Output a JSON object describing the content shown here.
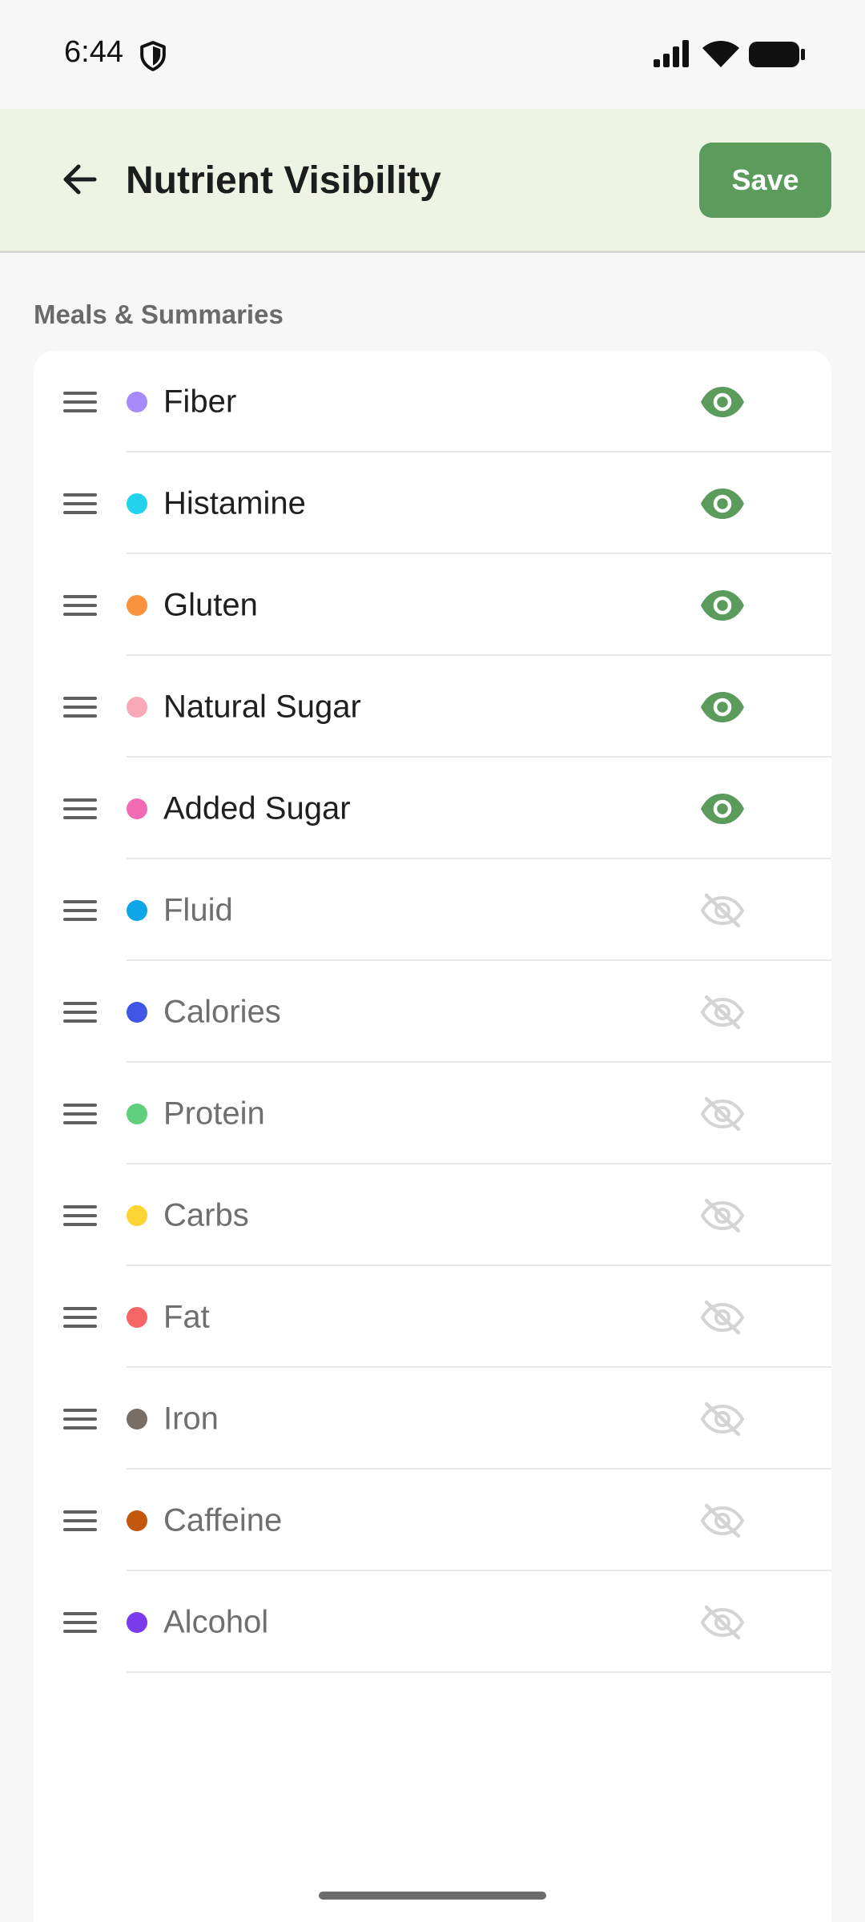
{
  "status_bar": {
    "time": "6:44"
  },
  "header": {
    "title": "Nutrient Visibility",
    "save_label": "Save"
  },
  "section": {
    "title": "Meals & Summaries"
  },
  "colors": {
    "accent": "#5b9b5b",
    "eye_visible": "#5b9b5b",
    "eye_hidden": "#d4d4d4"
  },
  "nutrients": [
    {
      "label": "Fiber",
      "color": "#a78bfa",
      "visible": true
    },
    {
      "label": "Histamine",
      "color": "#22d3ee",
      "visible": true
    },
    {
      "label": "Gluten",
      "color": "#fb923c",
      "visible": true
    },
    {
      "label": "Natural Sugar",
      "color": "#f9a8b8",
      "visible": true
    },
    {
      "label": "Added Sugar",
      "color": "#f06bb4",
      "visible": true
    },
    {
      "label": "Fluid",
      "color": "#0ea5e9",
      "visible": false
    },
    {
      "label": "Calories",
      "color": "#3f56e6",
      "visible": false
    },
    {
      "label": "Protein",
      "color": "#5fcf7e",
      "visible": false
    },
    {
      "label": "Carbs",
      "color": "#fcd535",
      "visible": false
    },
    {
      "label": "Fat",
      "color": "#f56565",
      "visible": false
    },
    {
      "label": "Iron",
      "color": "#786e66",
      "visible": false
    },
    {
      "label": "Caffeine",
      "color": "#c2570c",
      "visible": false
    },
    {
      "label": "Alcohol",
      "color": "#7c3aed",
      "visible": false
    }
  ]
}
